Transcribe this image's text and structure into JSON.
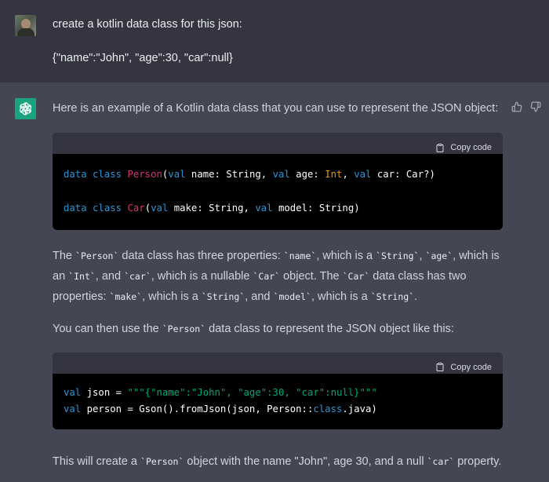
{
  "user": {
    "line1": "create a kotlin data class for this json:",
    "line2": "{\"name\":\"John\", \"age\":30, \"car\":null}"
  },
  "assistant": {
    "intro": "Here is an example of a Kotlin data class that you can use to represent the JSON object:",
    "copy_label": "Copy code",
    "code1": {
      "line1": {
        "t1": "data",
        "t2": "class",
        "t3": "Person",
        "t4": "(",
        "t5": "val",
        "t6": " name: String, ",
        "t7": "val",
        "t8": " age: ",
        "t9": "Int",
        "t10": ", ",
        "t11": "val",
        "t12": " car: Car?)"
      },
      "line2": {
        "t1": "data",
        "t2": "class",
        "t3": "Car",
        "t4": "(",
        "t5": "val",
        "t6": " make: String, ",
        "t7": "val",
        "t8": " model: String)"
      }
    },
    "p1": {
      "a": "The ",
      "b": "`Person`",
      "c": " data class has three properties: ",
      "d": "`name`",
      "e": ", which is a ",
      "f": "`String`",
      "g": ", ",
      "h": "`age`",
      "i": ", which is an ",
      "j": "`Int`",
      "k": ", and ",
      "l": "`car`",
      "m": ", which is a nullable ",
      "n": "`Car`",
      "o": " object. The ",
      "p": "`Car`",
      "q": " data class has two properties: ",
      "r": "`make`",
      "s": ", which is a ",
      "t": "`String`",
      "u": ", and ",
      "v": "`model`",
      "w": ", which is a ",
      "x": "`String`",
      "y": "."
    },
    "p2": {
      "a": "You can then use the ",
      "b": "`Person`",
      "c": " data class to represent the JSON object like this:"
    },
    "code2": {
      "line1": {
        "t1": "val",
        "t2": " json = ",
        "t3": "\"\"\"{\"name\":\"John\", \"age\":30, \"car\":null}\"\"\""
      },
      "line2": {
        "t1": "val",
        "t2": " person = Gson().fromJson(json, Person::",
        "t3": "class",
        "t4": ".java)"
      }
    },
    "p3": {
      "a": "This will create a ",
      "b": "`Person`",
      "c": " object with the name \"John\", age 30, and a null ",
      "d": "`car`",
      "e": " property."
    }
  },
  "icons": [
    "user-avatar",
    "chatgpt-logo-icon",
    "thumbs-up-icon",
    "thumbs-down-icon",
    "clipboard-icon"
  ]
}
